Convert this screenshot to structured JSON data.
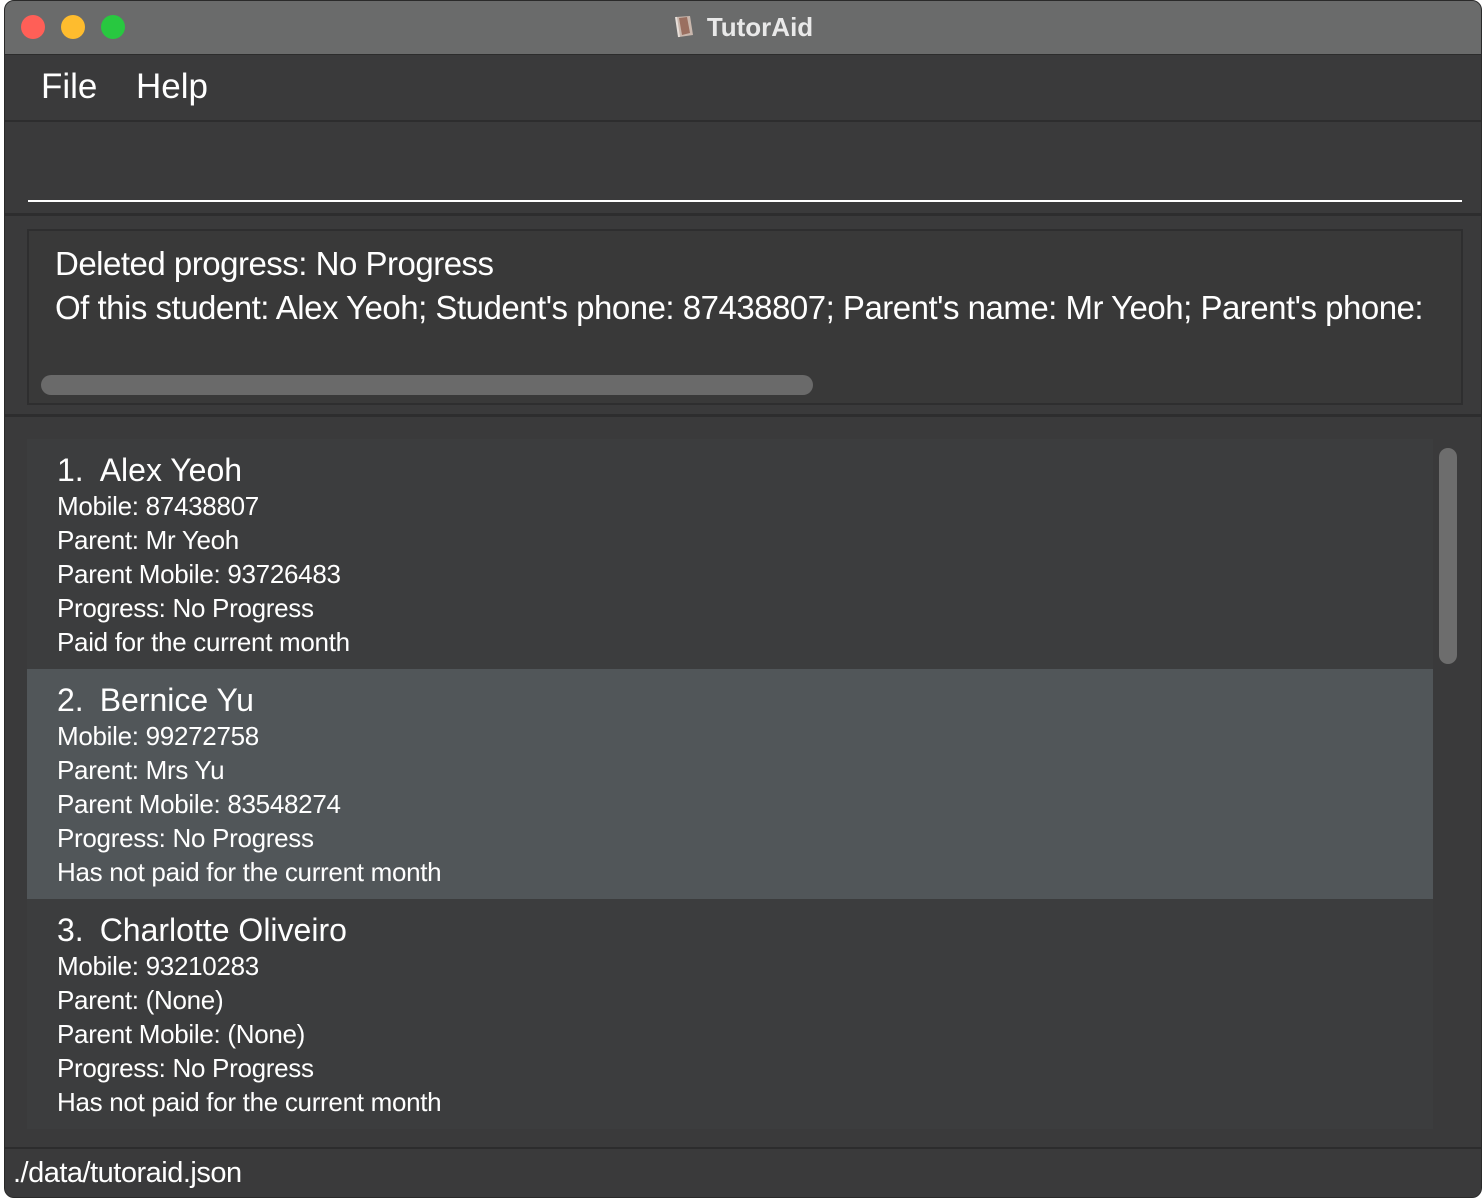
{
  "window": {
    "title": "TutorAid"
  },
  "menu": {
    "items": [
      "File",
      "Help"
    ]
  },
  "command": {
    "value": "",
    "placeholder": ""
  },
  "result": {
    "line1": "Deleted progress: No Progress",
    "line2": "Of this student: Alex Yeoh; Student's phone: 87438807; Parent's name: Mr Yeoh; Parent's phone:"
  },
  "students": [
    {
      "index": "1.",
      "name": "Alex Yeoh",
      "mobile": "Mobile: 87438807",
      "parent": "Parent: Mr Yeoh",
      "parent_mobile": "Parent Mobile: 93726483",
      "progress": "Progress: No Progress",
      "payment": "Paid for the current month"
    },
    {
      "index": "2.",
      "name": "Bernice Yu",
      "mobile": "Mobile: 99272758",
      "parent": "Parent: Mrs Yu",
      "parent_mobile": "Parent Mobile: 83548274",
      "progress": "Progress: No Progress",
      "payment": "Has not paid for the current month"
    },
    {
      "index": "3.",
      "name": "Charlotte Oliveiro",
      "mobile": "Mobile: 93210283",
      "parent": "Parent: (None)",
      "parent_mobile": "Parent Mobile: (None)",
      "progress": "Progress: No Progress",
      "payment": "Has not paid for the current month"
    }
  ],
  "status": {
    "file_path": "./data/tutoraid.json"
  },
  "colors": {
    "close": "#ff5f57",
    "minimize": "#febc2e",
    "maximize": "#28c840",
    "background": "#3a3a3b",
    "selected_row": "#515659"
  },
  "icons": {
    "app": "tutoraid-app-icon"
  }
}
